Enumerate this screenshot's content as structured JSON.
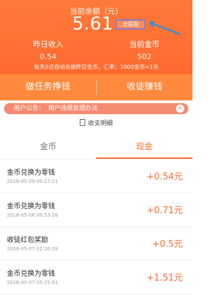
{
  "header": {
    "balance_label": "当前余额（元）",
    "balance_value": "5.61",
    "withdraw_label": "去提现",
    "stats": [
      {
        "label": "昨日收入",
        "value": "0.54"
      },
      {
        "label": "当前金币",
        "value": "502"
      }
    ],
    "notice": "每天0点自动兑换昨日金币，汇率：1000金币=1元"
  },
  "actions": {
    "tasks": "做任务挣钱",
    "recruit": "收徒赚钱"
  },
  "announcement": {
    "label": "用户公告：",
    "text": "用户违规处理办法"
  },
  "details_link": "收支明细",
  "tabs": [
    "金币",
    "现金"
  ],
  "transactions": [
    {
      "title": "金币兑换为零钱",
      "time": "2018-05-09 00:27:21",
      "amount": "+0.54元"
    },
    {
      "title": "金币兑换为零钱",
      "time": "2018-05-08 00:53:16",
      "amount": "+0.71元"
    },
    {
      "title": "收徒红包奖励",
      "time": "2018-05-07 02:26:39",
      "amount": "+0.5元"
    },
    {
      "title": "金币兑换为零钱",
      "time": "2018-05-07 00:25:01",
      "amount": "+1.51元"
    }
  ],
  "colors": {
    "accent": "#ff6a2f",
    "header": "#ff7a3a",
    "announce": "#f48a6f",
    "highlight_box": "#8a7bd0"
  },
  "icons": [
    "arrow-icon",
    "close-icon",
    "doc-icon"
  ]
}
